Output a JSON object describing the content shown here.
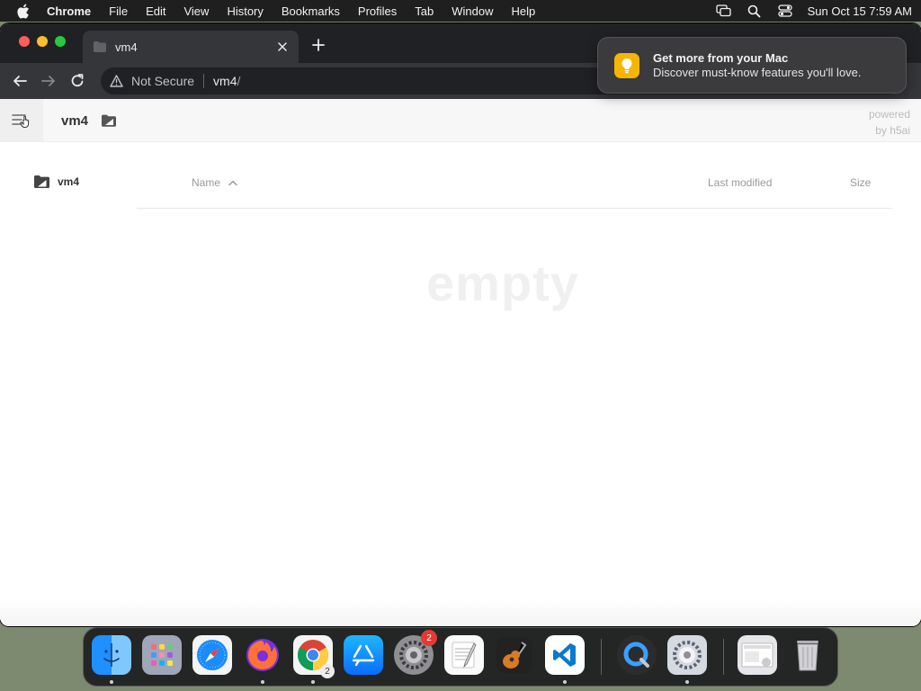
{
  "menubar": {
    "app_name": "Chrome",
    "menus": [
      "File",
      "Edit",
      "View",
      "History",
      "Bookmarks",
      "Profiles",
      "Tab",
      "Window",
      "Help"
    ],
    "clock": "Sun Oct 15  7:59 AM"
  },
  "browser": {
    "tab_title": "vm4",
    "address": {
      "security_label": "Not Secure",
      "url_host": "vm4",
      "url_path": "/"
    }
  },
  "notification": {
    "title": "Get more from your Mac",
    "body": "Discover must-know features you'll love."
  },
  "page": {
    "breadcrumb_title": "vm4",
    "powered_line1": "powered",
    "powered_line2": "by h5ai",
    "tree_root": "vm4",
    "columns": {
      "name": "Name",
      "last_modified": "Last modified",
      "size": "Size"
    },
    "empty_label": "empty"
  },
  "dock": {
    "apps": [
      {
        "name": "Finder",
        "running": true
      },
      {
        "name": "Launchpad",
        "running": false
      },
      {
        "name": "Safari",
        "running": false
      },
      {
        "name": "Firefox",
        "running": true
      },
      {
        "name": "Chrome",
        "running": true,
        "mini_badge": "2"
      },
      {
        "name": "App Store",
        "running": false
      },
      {
        "name": "System Preferences",
        "running": false,
        "badge": "2"
      },
      {
        "name": "TextEdit",
        "running": false
      },
      {
        "name": "GarageBand",
        "running": false
      },
      {
        "name": "Visual Studio Code",
        "running": true
      },
      {
        "name": "QuickTime Player",
        "running": false
      },
      {
        "name": "System Settings",
        "running": true
      },
      {
        "name": "Downloads Stack",
        "running": false
      },
      {
        "name": "Trash",
        "running": false
      }
    ]
  }
}
